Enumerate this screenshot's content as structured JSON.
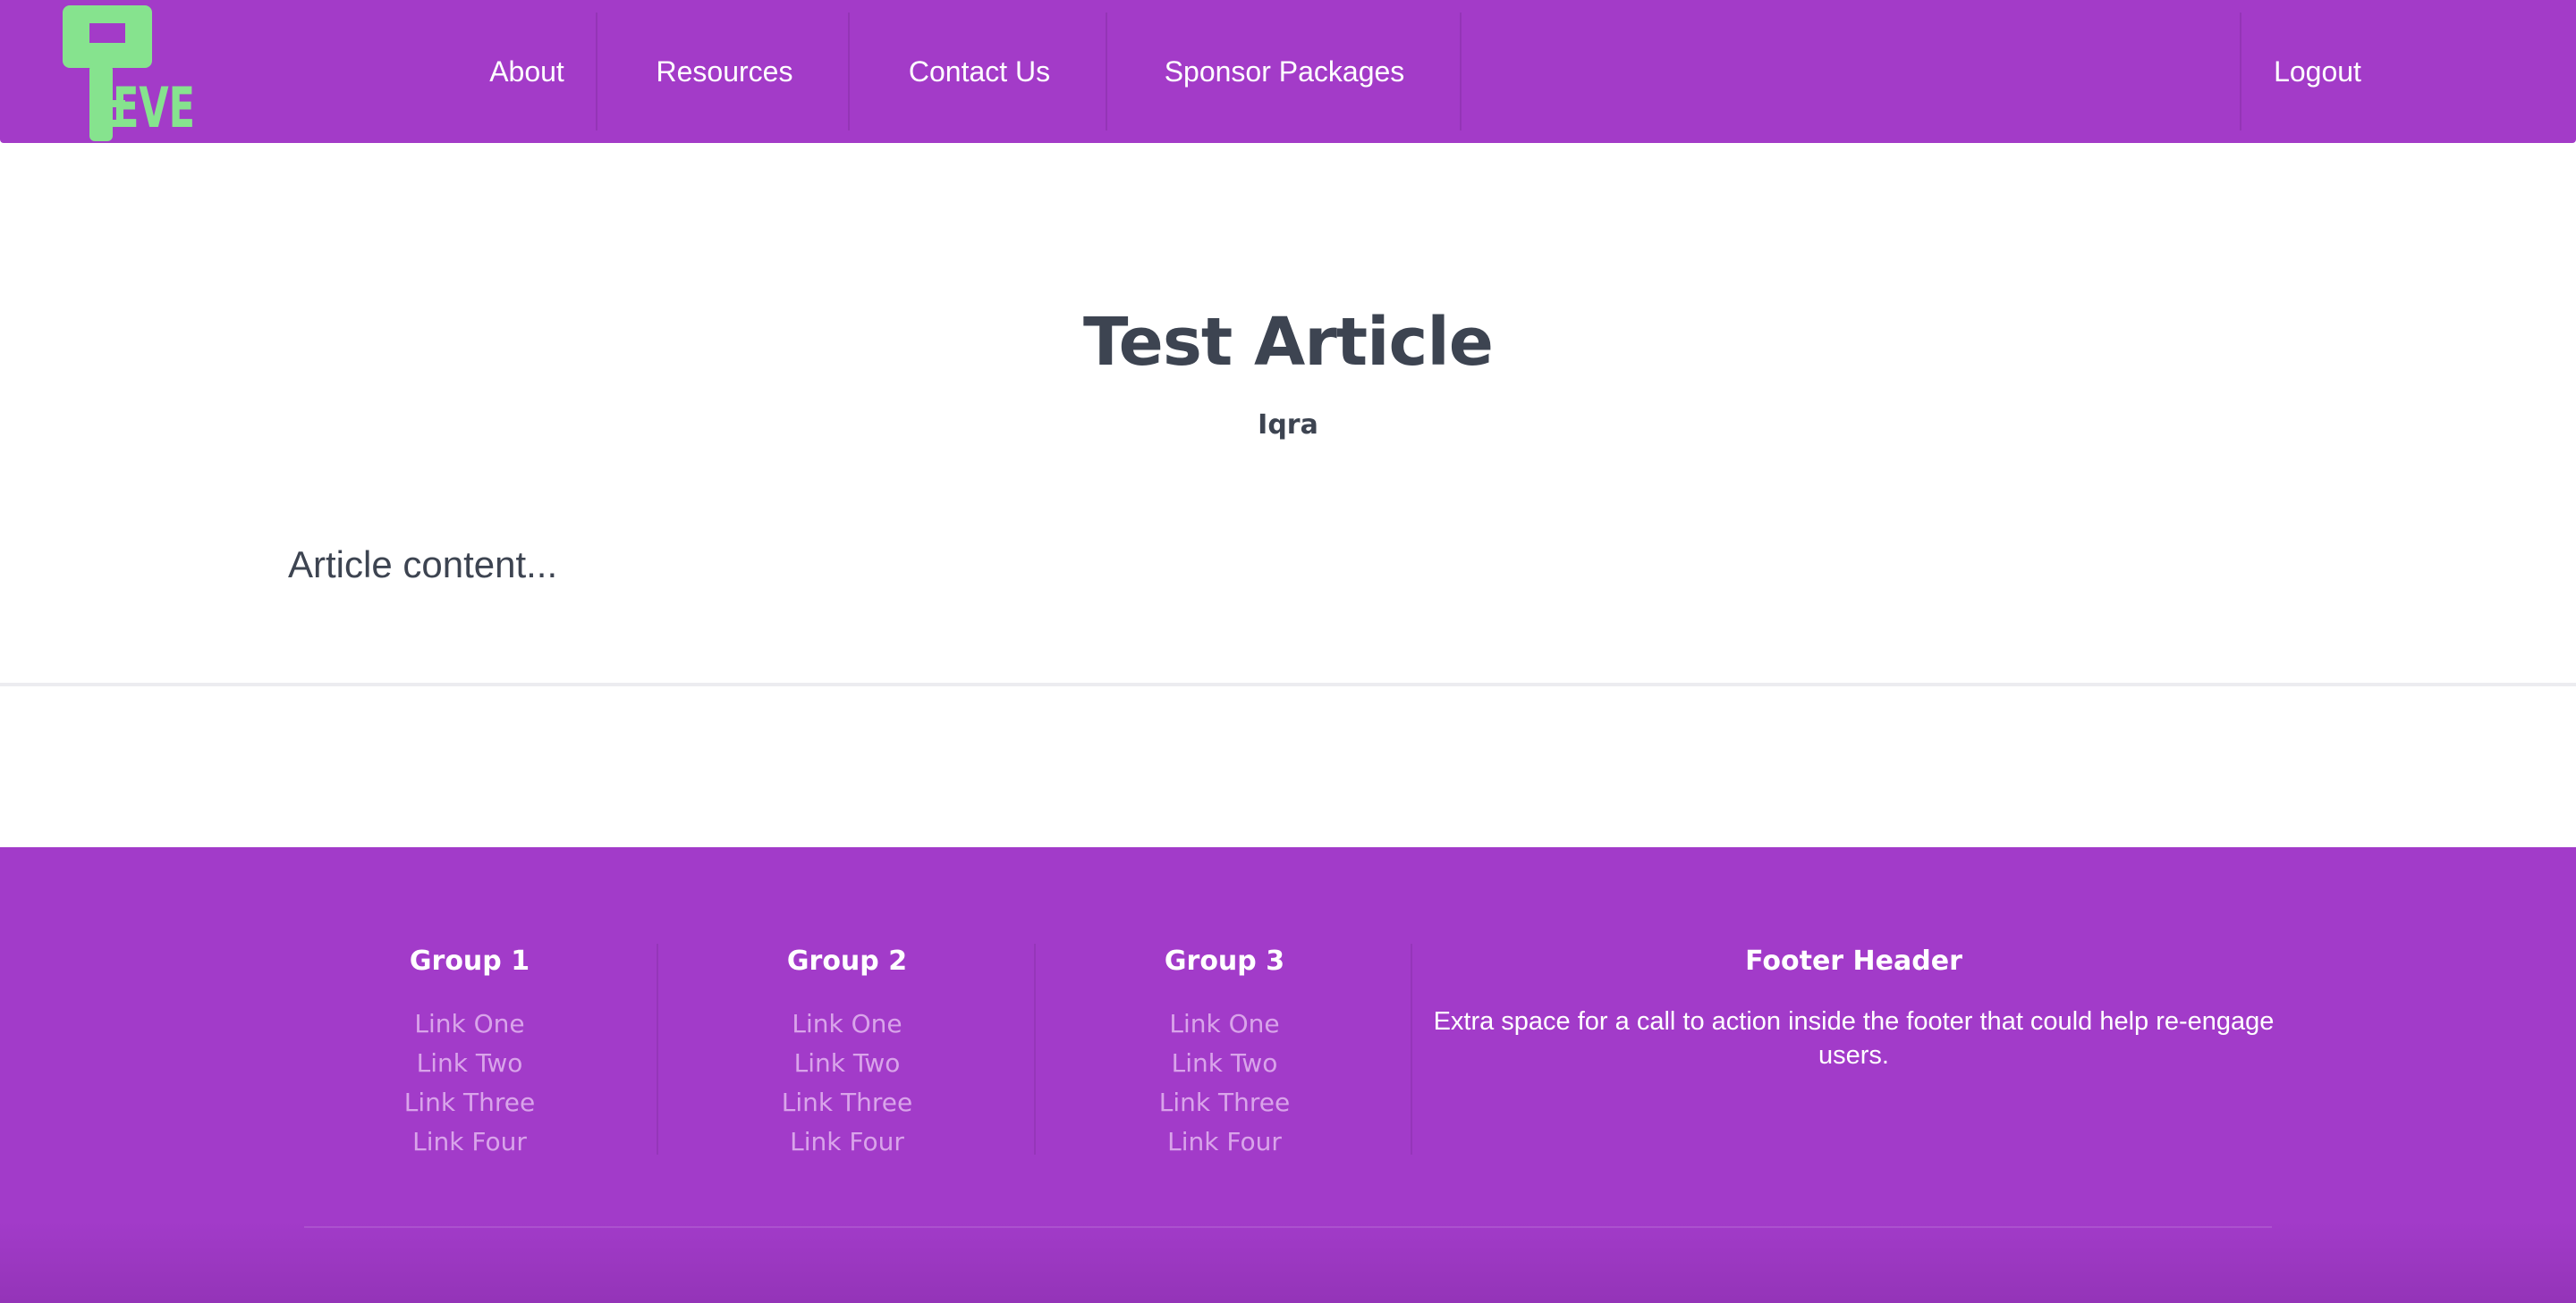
{
  "nav": {
    "logo_text": "EVE",
    "items": [
      {
        "label": "About"
      },
      {
        "label": "Resources"
      },
      {
        "label": "Contact Us"
      },
      {
        "label": "Sponsor Packages"
      }
    ],
    "logout_label": "Logout"
  },
  "article": {
    "title": "Test Article",
    "author": "Iqra",
    "content": "Article content..."
  },
  "footer": {
    "groups": [
      {
        "title": "Group 1",
        "links": [
          "Link One",
          "Link Two",
          "Link Three",
          "Link Four"
        ]
      },
      {
        "title": "Group 2",
        "links": [
          "Link One",
          "Link Two",
          "Link Three",
          "Link Four"
        ]
      },
      {
        "title": "Group 3",
        "links": [
          "Link One",
          "Link Two",
          "Link Three",
          "Link Four"
        ]
      }
    ],
    "cta": {
      "title": "Footer Header",
      "text": "Extra space for a call to action inside the footer that could help re-engage users."
    }
  },
  "colors": {
    "brand_purple": "#a33bc8",
    "logo_green": "#86e38e",
    "text_dark": "#3d4451",
    "footer_link": "#d9a4ea"
  }
}
